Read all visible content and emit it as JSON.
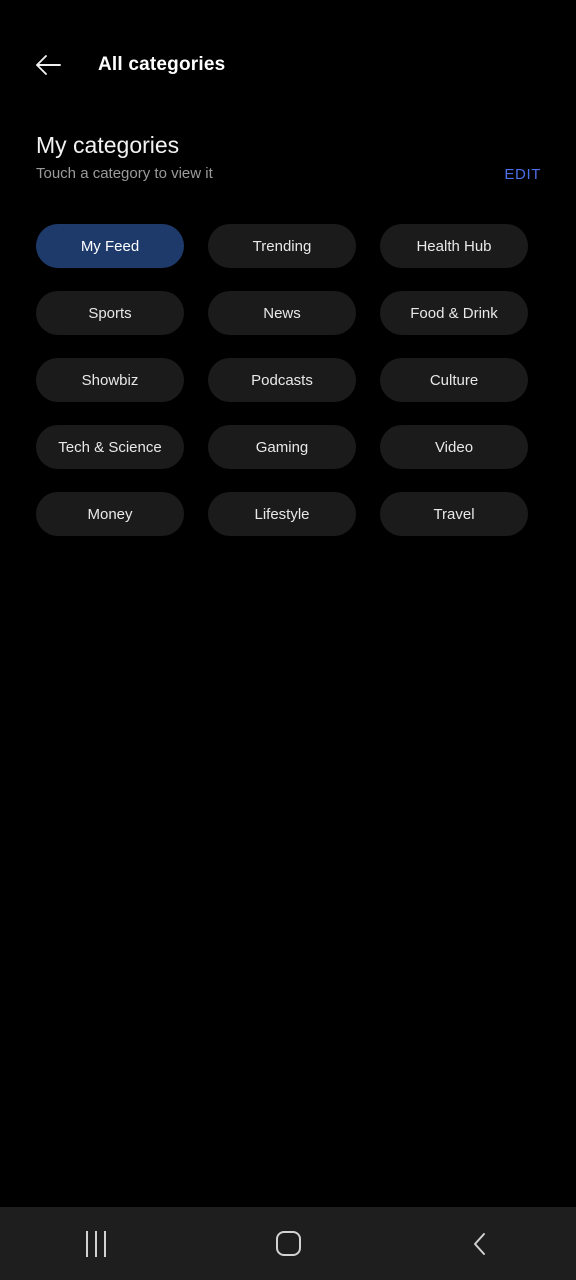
{
  "appbar": {
    "back_icon": "arrow-left-icon",
    "title": "All categories"
  },
  "section": {
    "title": "My categories",
    "subtitle": "Touch a category to view it",
    "edit_label": "EDIT",
    "edit_color": "#4d6fe8"
  },
  "categories": [
    {
      "label": "My Feed",
      "selected": true
    },
    {
      "label": "Trending",
      "selected": false
    },
    {
      "label": "Health Hub",
      "selected": false
    },
    {
      "label": "Sports",
      "selected": false
    },
    {
      "label": "News",
      "selected": false
    },
    {
      "label": "Food & Drink",
      "selected": false
    },
    {
      "label": "Showbiz",
      "selected": false
    },
    {
      "label": "Podcasts",
      "selected": false
    },
    {
      "label": "Culture",
      "selected": false
    },
    {
      "label": "Tech & Science",
      "selected": false
    },
    {
      "label": "Gaming",
      "selected": false
    },
    {
      "label": "Video",
      "selected": false
    },
    {
      "label": "Money",
      "selected": false
    },
    {
      "label": "Lifestyle",
      "selected": false
    },
    {
      "label": "Travel",
      "selected": false
    }
  ],
  "chip_colors": {
    "selected_background": "#1d3a6b",
    "default_background": "#1b1b1b",
    "text": "#e8e8e8"
  },
  "navbar": {
    "background": "#1e1e1e",
    "buttons": [
      {
        "name": "recents-icon"
      },
      {
        "name": "home-icon"
      },
      {
        "name": "back-icon"
      }
    ]
  }
}
